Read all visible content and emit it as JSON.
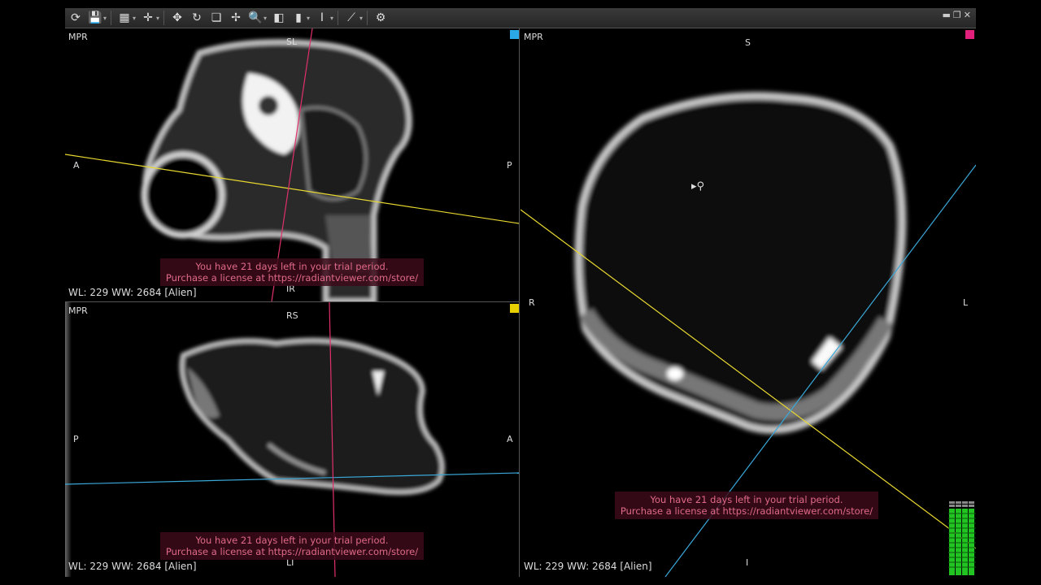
{
  "toolbar": {
    "buttons": [
      "sync-icon",
      "save-icon",
      "layout-icon",
      "crosshair-icon",
      "pan-icon",
      "rotate-icon",
      "stack-icon",
      "move-icon",
      "zoom-icon",
      "window-level-icon",
      "measure-icon",
      "tools-icon",
      "settings-icon"
    ]
  },
  "window_controls": {
    "minimize": "▬",
    "restore": "❐",
    "close": "✕"
  },
  "viewports": [
    {
      "mode": "MPR",
      "top": "SL",
      "left": "A",
      "right": "P",
      "bottom": "IR",
      "wl": "WL: 229 WW: 2684 [Alien]",
      "corner_color": "#2aa8e8",
      "trial_line1": "You have 21 days left in your trial period.",
      "trial_line2": "Purchase a license at https://radiantviewer.com/store/"
    },
    {
      "mode": "MPR",
      "top": "RS",
      "left": "P",
      "right": "A",
      "bottom": "LI",
      "wl": "WL: 229 WW: 2684 [Alien]",
      "corner_color": "#e8d000",
      "trial_line1": "You have 21 days left in your trial period.",
      "trial_line2": "Purchase a license at https://radiantviewer.com/store/"
    },
    {
      "mode": "MPR",
      "top": "S",
      "left": "R",
      "right": "L",
      "bottom": "I",
      "wl": "WL: 229 WW: 2684 [Alien]",
      "corner_color": "#e0207a",
      "trial_line1": "You have 21 days left in your trial period.",
      "trial_line2": "Purchase a license at https://radiantviewer.com/store/"
    }
  ],
  "colors": {
    "yellow_line": "#e8d830",
    "cyan_line": "#3aa8d8",
    "magenta_line": "#e0306a",
    "meter": "#22c422"
  }
}
